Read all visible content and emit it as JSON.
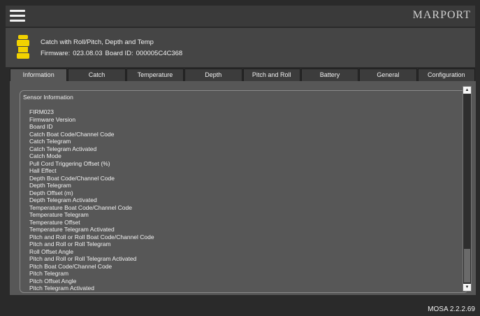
{
  "header": {
    "menu_icon": "hamburger-menu-icon",
    "logo_text": "MARPORT"
  },
  "device": {
    "icon": "catch-sensor-icon",
    "title": "Catch with Roll/Pitch, Depth and Temp",
    "firmware_label": "Firmware:",
    "firmware_value": "023.08.03",
    "board_label": "Board ID:",
    "board_value": "000005C4C368",
    "icon_color": "#f2d200"
  },
  "tabs": [
    {
      "label": "Information",
      "active": true
    },
    {
      "label": "Catch"
    },
    {
      "label": "Temperature"
    },
    {
      "label": "Depth"
    },
    {
      "label": "Pitch and Roll"
    },
    {
      "label": "Battery"
    },
    {
      "label": "General"
    },
    {
      "label": "Configuration"
    }
  ],
  "panel": {
    "title": "Sensor Information",
    "items": [
      "FIRM023",
      "Firmware Version",
      "Board ID",
      "Catch Boat Code/Channel Code",
      "Catch Telegram",
      "Catch Telegram Activated",
      "Catch Mode",
      "Pull Cord Triggering Offset (%)",
      "Hall Effect",
      "Depth Boat Code/Channel Code",
      "Depth Telegram",
      "Depth Offset (m)",
      "Depth Telegram Activated",
      "Temperature Boat Code/Channel Code",
      "Temperature Telegram",
      "Temperature Offset",
      "Temperature Telegram Activated",
      "Pitch and Roll or Roll Boat Code/Channel Code",
      "Pitch and Roll or Roll Telegram",
      "Roll Offset Angle",
      "Pitch and Roll or Roll Telegram Activated",
      "Pitch Boat Code/Channel Code",
      "Pitch Telegram",
      "Pitch Offset Angle",
      "Pitch Telegram Activated"
    ],
    "scroll_up_icon": "scroll-up-arrow-icon",
    "scroll_down_icon": "scroll-down-arrow-icon"
  },
  "footer": {
    "version": "MOSA 2.2.2.69"
  }
}
